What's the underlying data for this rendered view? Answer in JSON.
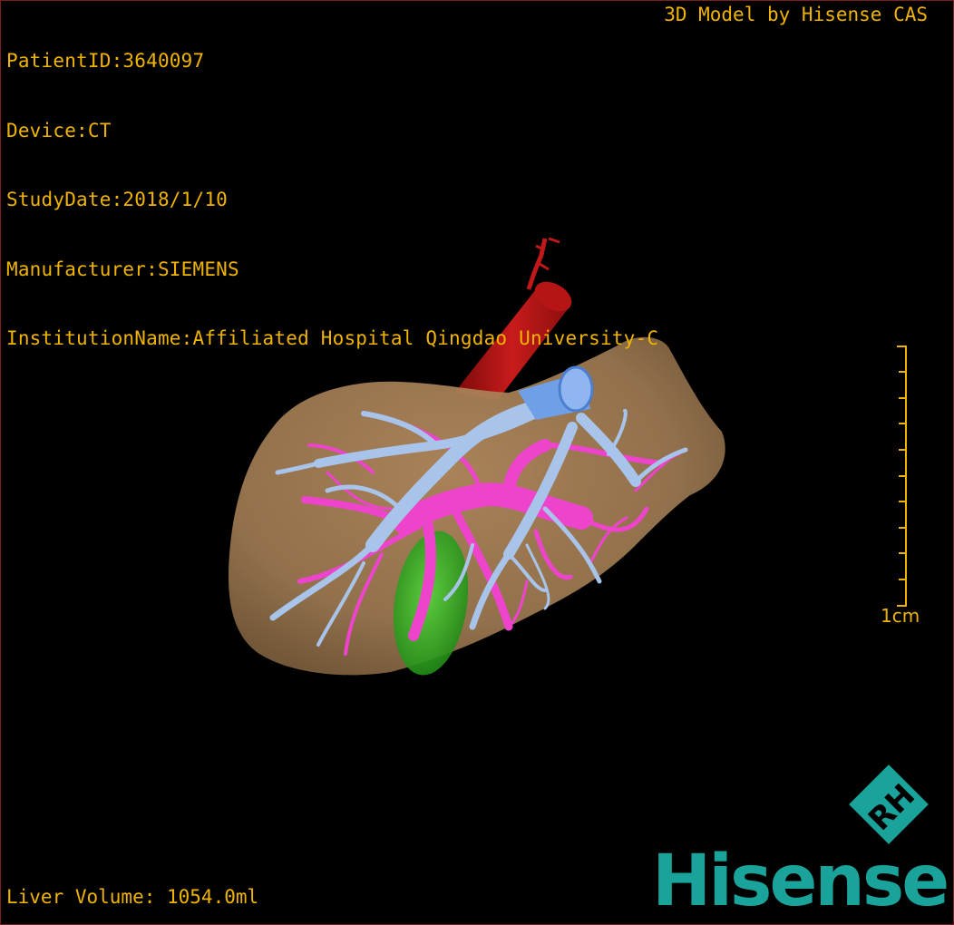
{
  "patient": {
    "id_line": "PatientID:3640097",
    "device_line": "Device:CT",
    "date_line": "StudyDate:2018/1/10",
    "manufacturer_line": "Manufacturer:SIEMENS",
    "institution_line": "InstitutionName:Affiliated Hospital Qingdao University-C"
  },
  "header": {
    "brand_caption": "3D Model by Hisense CAS"
  },
  "scale": {
    "label": "1cm"
  },
  "footer": {
    "liver_volume": "Liver Volume: 1054.0ml"
  },
  "logo": {
    "wordmark": "Hisense",
    "badge_text": "RH"
  },
  "colors": {
    "overlay_text": "#f0b400",
    "liver": "#a67f55",
    "hepatic_vein": "#a8c4ea",
    "portal_vein": "#ee44cc",
    "aorta": "#b81414",
    "vena_cava": "#6f9fe6",
    "gallbladder": "#2fb022",
    "brand": "#1aa39a"
  }
}
